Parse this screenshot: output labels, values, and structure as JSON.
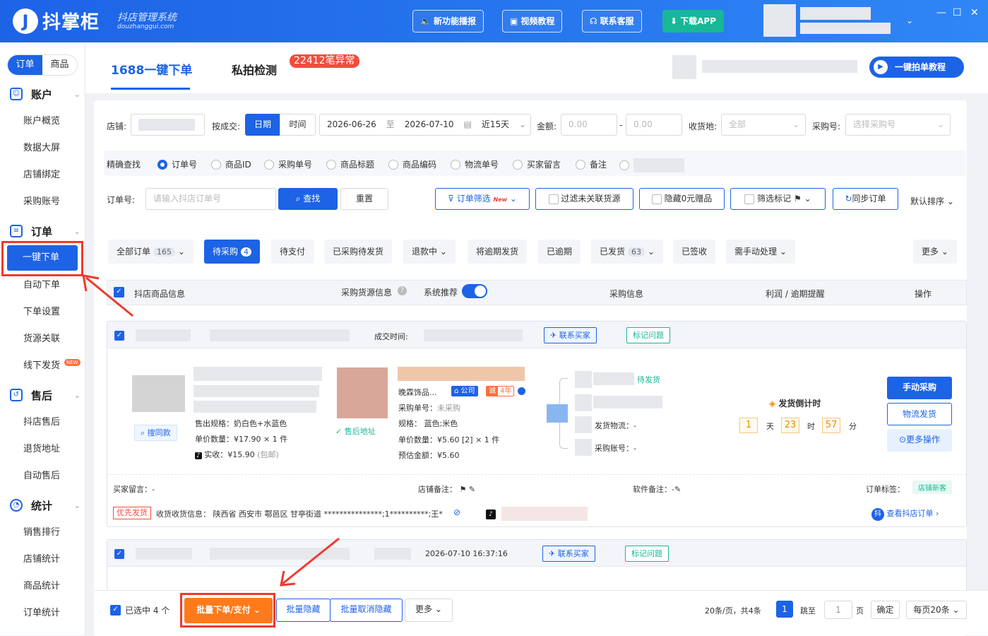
{
  "header": {
    "logo_glyph": "J",
    "app_name": "抖掌柜",
    "app_subtitle": "抖店管理系统",
    "app_url": "douzhanggui.com",
    "buttons": [
      {
        "label": "新功能播报",
        "icon": "speaker-icon"
      },
      {
        "label": "视频教程",
        "icon": "video-icon"
      },
      {
        "label": "联系客服",
        "icon": "headset-icon"
      },
      {
        "label": "下载APP",
        "icon": "download-icon"
      }
    ],
    "window_controls": {
      "minimize": "—",
      "maximize": "☐",
      "close": "✕"
    }
  },
  "sidebar": {
    "toggle": [
      "订单",
      "商品"
    ],
    "groups": [
      {
        "title": "账户",
        "icon": "account-icon",
        "items": [
          "账户概览",
          "数据大屏",
          "店铺绑定",
          "采购账号"
        ]
      },
      {
        "title": "订单",
        "icon": "order-icon",
        "items": [
          "一键下单",
          "自动下单",
          "下单设置",
          "货源关联",
          "线下发货"
        ]
      },
      {
        "title": "售后",
        "icon": "aftersale-icon",
        "items": [
          "抖店售后",
          "退货地址",
          "自动售后"
        ]
      },
      {
        "title": "统计",
        "icon": "stats-icon",
        "items": [
          "销售排行",
          "店铺统计",
          "商品统计",
          "订单统计"
        ]
      }
    ],
    "new_badge": "NEW"
  },
  "top_tabs": {
    "tab1": "1688一键下单",
    "tab2": "私拍检测",
    "tab2_badge": "22412笔异常",
    "tutorial_button": "一键拍单教程"
  },
  "filters": {
    "shop_label": "店铺:",
    "deal_label": "按成交:",
    "date_mode": [
      "日期",
      "时间"
    ],
    "date_start": "2026-06-26",
    "date_sep": "至",
    "date_end": "2026-07-10",
    "date_range": "近15天",
    "amount_label": "金额:",
    "amount_min": "0.00",
    "amount_max": "0.00",
    "amount_sep": "-",
    "ship_label": "收货地:",
    "ship_value": "全部",
    "purchase_label": "采购号:",
    "purchase_placeholder": "选择采购号",
    "exact_label": "精确查找",
    "exact_options": [
      "订单号",
      "商品ID",
      "采购单号",
      "商品标题",
      "商品编码",
      "物流单号",
      "买家留言",
      "备注"
    ],
    "order_label": "订单号:",
    "order_placeholder": "请输入抖店订单号",
    "search": "查找",
    "reset": "重置",
    "order_filter": "订单筛选",
    "order_filter_new": "New",
    "unlinked": "过滤未关联货源",
    "hide_zero": "隐藏0元赠品",
    "flag_filter": "筛选标记",
    "sync": "同步订单",
    "sort": "默认排序"
  },
  "status_tabs": [
    {
      "label": "全部订单",
      "count": "165"
    },
    {
      "label": "待采购",
      "count": "4"
    },
    {
      "label": "待支付",
      "count": ""
    },
    {
      "label": "已采购待发货",
      "count": ""
    },
    {
      "label": "退款中",
      "count": ""
    },
    {
      "label": "将逾期发货",
      "count": ""
    },
    {
      "label": "已逾期",
      "count": ""
    },
    {
      "label": "已发货",
      "count": "63"
    },
    {
      "label": "已签收",
      "count": ""
    },
    {
      "label": "需手动处理",
      "count": ""
    }
  ],
  "more": "更多",
  "table_head": {
    "col1": "抖店商品信息",
    "col2": "采购货源信息",
    "recommend": "系统推荐",
    "col3": "采购信息",
    "col4": "利润 / 逾期提醒",
    "col5": "操作"
  },
  "order1": {
    "deal_time_label": "成交时间:",
    "contact": "联系买家",
    "mark": "标记问题",
    "find_same": "搜同款",
    "spec": "售出规格：奶白色+水蓝色",
    "unit_qty": "单价数量：¥17.90 × 1 件",
    "received": "实收：¥15.90",
    "received_note": "(包邮)",
    "after_addr": "售后地址",
    "supplier": "晚霖饰品...",
    "company": "公司",
    "cheng": "诚",
    "years": "4年",
    "purchase_no": "采购单号：",
    "purchase_no_val": "未采购",
    "purchase_spec": "规格：  蓝色;米色",
    "purchase_unit": "单价数量：¥5.60 [2] × 1 件",
    "purchase_est": "预估金额：¥5.60",
    "pending_ship": "待发货",
    "logistics": "发货物流：-",
    "purchase_acct": "采购账号：-",
    "countdown_title": "发货倒计时",
    "days": "1",
    "day_unit": "天",
    "hours": "23",
    "hour_unit": "时",
    "mins": "57",
    "min_unit": "分",
    "manual_buy": "手动采购",
    "ship": "物流发货",
    "more_ops": "更多操作",
    "buyer_msg": "买家留言：-",
    "shop_note": "店铺备注：",
    "soft_note": "软件备注：-",
    "order_tag": "订单标签：",
    "tag_new": "店铺新客",
    "priority": "优先发货",
    "address": "收货收货信息：  陕西省 西安市 鄠邑区 甘亭街道 ***************;1**********;王*",
    "view_order": "查看抖店订单"
  },
  "order2": {
    "time": "2026-07-10 16:37:16",
    "contact": "联系买家",
    "mark": "标记问题"
  },
  "footer": {
    "selected": "已选中 4 个",
    "batch_order": "批量下单/支付",
    "batch_hide": "批量隐藏",
    "batch_unhide": "批量取消隐藏",
    "more": "更多",
    "page_info": "20条/页，共4条",
    "page": "1",
    "jump": "跳至",
    "jump_val": "1",
    "page_unit": "页",
    "confirm": "确定",
    "per_page": "每页20条"
  }
}
